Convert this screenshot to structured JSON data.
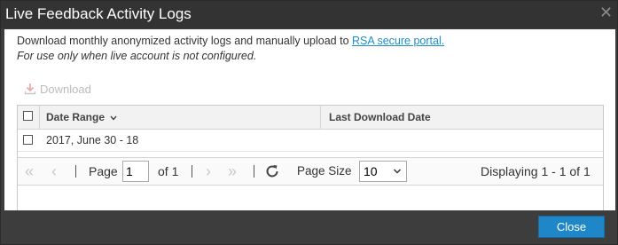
{
  "dialog": {
    "title": "Live Feedback Activity Logs",
    "close_icon": "close-icon"
  },
  "body": {
    "description": "Download monthly anonymized activity logs and manually upload to ",
    "link_text": "RSA secure portal.",
    "note": "For use only when live account is not configured."
  },
  "toolbar": {
    "download_label": "Download",
    "download_icon": "download-icon"
  },
  "grid": {
    "columns": [
      {
        "label": "Date Range",
        "sort": "chevron-down-icon"
      },
      {
        "label": "Last Download Date"
      }
    ],
    "rows": [
      {
        "date_range": "2017, June 30 - 18",
        "last_download": ""
      }
    ]
  },
  "pager": {
    "page_label": "Page",
    "page_value": "1",
    "of_label": "of 1",
    "page_size_label": "Page Size",
    "page_size_value": "10",
    "displaying": "Displaying 1 - 1 of 1"
  },
  "footer": {
    "close_label": "Close"
  },
  "colors": {
    "accent": "#1f86c7",
    "titlebar": "#333333",
    "link": "#1a8fc9"
  }
}
